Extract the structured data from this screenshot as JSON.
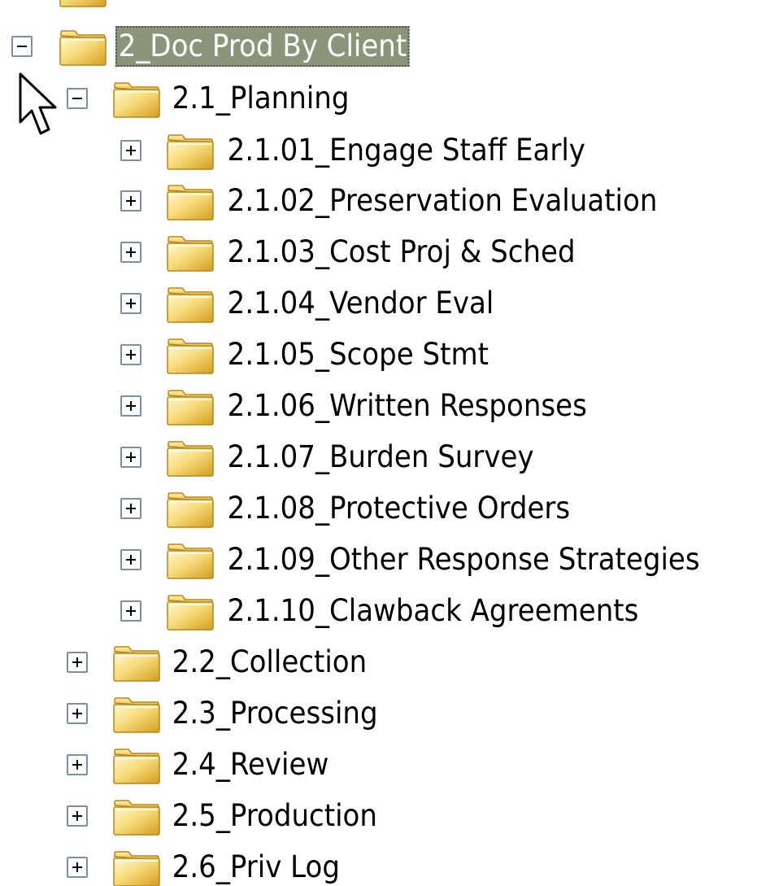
{
  "selected_node": "2_Doc Prod By Client",
  "colors": {
    "selection_background": "#8b9579",
    "selection_text": "#ffffff",
    "folder_light": "#fff6c8",
    "folder_dark": "#d9a520",
    "expander_border": "#7a8fa8"
  },
  "tree": {
    "clipped_top_item": {
      "label": "",
      "icon": "folder-icon"
    },
    "root": {
      "label": "2_Doc Prod By Client",
      "expanded": true,
      "selected": true,
      "icon": "folder-icon"
    },
    "planning": {
      "label": "2.1_Planning",
      "expanded": true,
      "icon": "folder-icon",
      "children": [
        {
          "label": "2.1.01_Engage Staff Early",
          "expanded": false
        },
        {
          "label": "2.1.02_Preservation Evaluation",
          "expanded": false
        },
        {
          "label": "2.1.03_Cost Proj & Sched",
          "expanded": false
        },
        {
          "label": "2.1.04_Vendor Eval",
          "expanded": false
        },
        {
          "label": "2.1.05_Scope Stmt",
          "expanded": false
        },
        {
          "label": "2.1.06_Written Responses",
          "expanded": false
        },
        {
          "label": "2.1.07_Burden Survey",
          "expanded": false
        },
        {
          "label": "2.1.08_Protective Orders",
          "expanded": false
        },
        {
          "label": "2.1.09_Other Response Strategies",
          "expanded": false
        },
        {
          "label": "2.1.10_Clawback Agreements",
          "expanded": false
        }
      ]
    },
    "siblings": [
      {
        "label": "2.2_Collection",
        "expanded": false
      },
      {
        "label": "2.3_Processing",
        "expanded": false
      },
      {
        "label": "2.4_Review",
        "expanded": false
      },
      {
        "label": "2.5_Production",
        "expanded": false
      },
      {
        "label": "2.6_Priv Log",
        "expanded": false
      }
    ]
  },
  "cursor": {
    "icon": "mouse-pointer-icon"
  }
}
